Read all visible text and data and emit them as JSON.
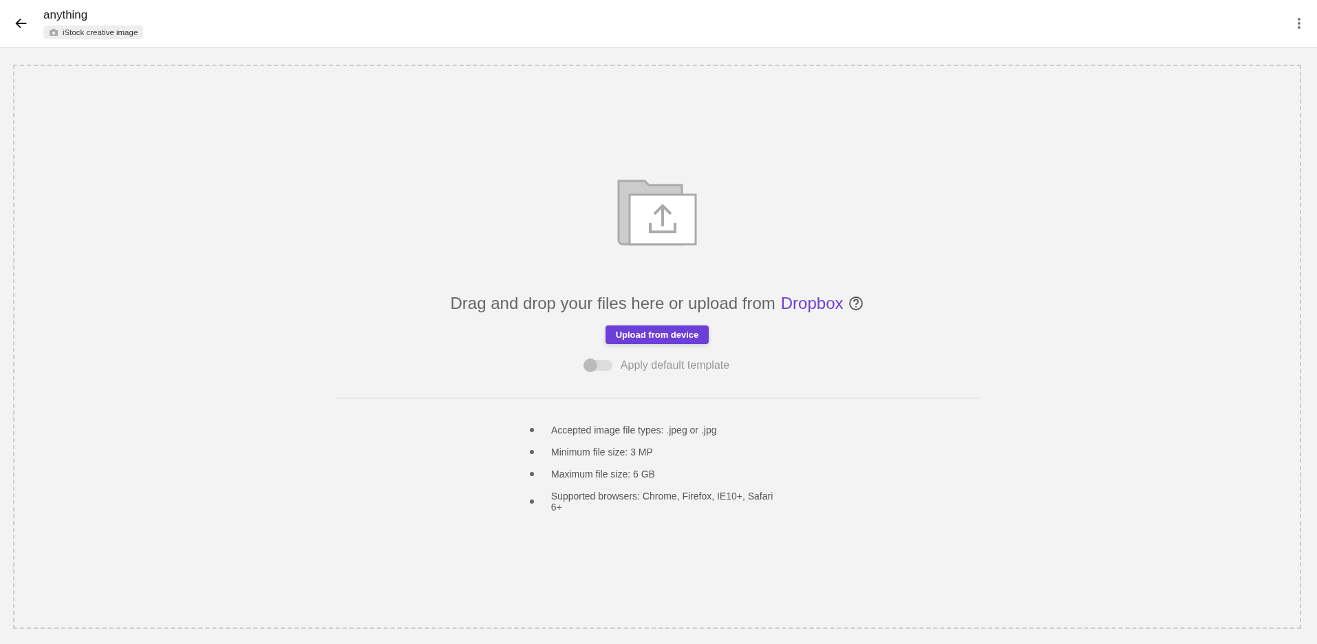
{
  "header": {
    "title": "anything",
    "tag": "iStock creative image"
  },
  "dropzone": {
    "prompt": "Drag and drop your files here or upload from",
    "link": "Dropbox",
    "button": "Upload from device",
    "toggle": {
      "label": "Apply default template",
      "on": false
    },
    "requirements": [
      "Accepted image file types: .jpeg or .jpg",
      "Minimum file size: 3 MP",
      "Maximum file size: 6 GB",
      "Supported browsers: Chrome, Firefox, IE10+, Safari 6+"
    ]
  }
}
